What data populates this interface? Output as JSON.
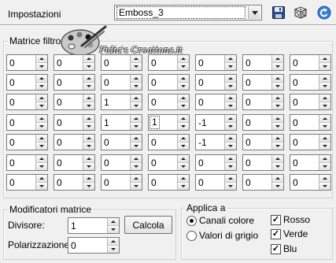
{
  "settings": {
    "label": "Impostazioni",
    "preset_value": "Emboss_3"
  },
  "toolbar": {
    "icons": [
      "save-icon",
      "dice-random-icon",
      "reset-icon"
    ]
  },
  "matrix": {
    "title": "Matrice filtro",
    "rows": [
      [
        "0",
        "0",
        "0",
        "0",
        "0",
        "0",
        "0"
      ],
      [
        "0",
        "0",
        "0",
        "0",
        "0",
        "0",
        "0"
      ],
      [
        "0",
        "0",
        "1",
        "0",
        "0",
        "0",
        "0"
      ],
      [
        "0",
        "0",
        "1",
        "1",
        "-1",
        "0",
        "0"
      ],
      [
        "0",
        "0",
        "0",
        "0",
        "-1",
        "0",
        "0"
      ],
      [
        "0",
        "0",
        "0",
        "0",
        "0",
        "0",
        "0"
      ],
      [
        "0",
        "0",
        "0",
        "0",
        "0",
        "0",
        "0"
      ]
    ]
  },
  "watermark": {
    "text": "Fidia's Creations.it"
  },
  "modifiers": {
    "title": "Modificatori matrice",
    "divisor_label": "Divisore:",
    "divisor_value": "1",
    "bias_label": "Polarizzazione:",
    "bias_value": "0",
    "calc_button": "Calcola"
  },
  "apply": {
    "title": "Applica a",
    "radio_color": "Canali colore",
    "radio_gray": "Valori di grigio",
    "check_red": "Rosso",
    "check_green": "Verde",
    "check_blue": "Blu"
  }
}
